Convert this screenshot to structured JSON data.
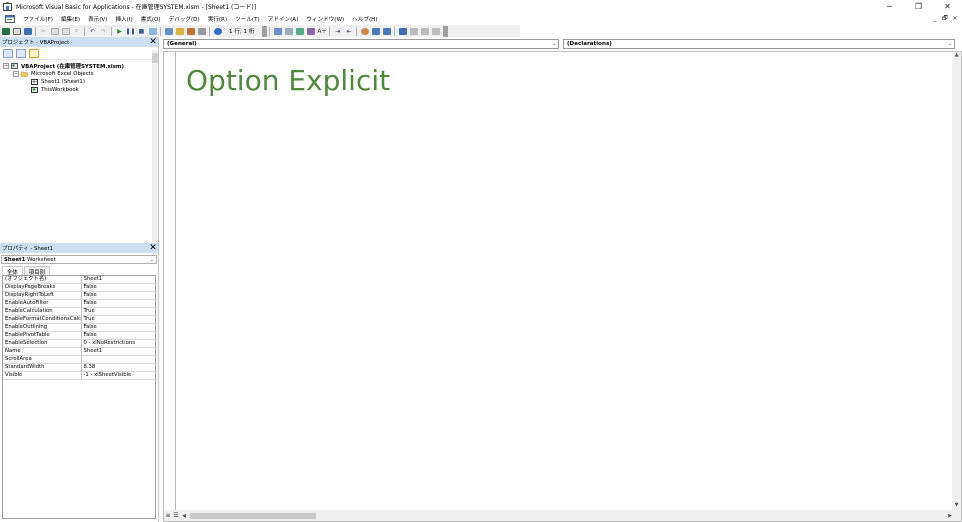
{
  "window": {
    "title": "Microsoft Visual Basic for Applications - 在庫管理SYSTEM.xlsm - [Sheet1 (コード)]",
    "minimize": "─",
    "restore": "❐",
    "close": "✕"
  },
  "menubar": {
    "items": [
      "ファイル(F)",
      "編集(E)",
      "表示(V)",
      "挿入(I)",
      "書式(O)",
      "デバッグ(D)",
      "実行(R)",
      "ツール(T)",
      "アドイン(A)",
      "ウィンドウ(W)",
      "ヘルプ(H)"
    ],
    "mdi_min": "_",
    "mdi_restore": "🗗",
    "mdi_close": "✕"
  },
  "toolbar": {
    "cursor_position": "1 行, 1 桁"
  },
  "project_panel": {
    "title": "プロジェクト - VBAProject",
    "close": "✕",
    "tree": {
      "root": "VBAProject (在庫管理SYSTEM.xlsm)",
      "folder": "Microsoft Excel Objects",
      "items": [
        "Sheet1 (Sheet1)",
        "ThisWorkbook"
      ]
    }
  },
  "properties_panel": {
    "title": "プロパティ - Sheet1",
    "close": "✕",
    "object_name": "Sheet1",
    "object_type": "Worksheet",
    "tabs": [
      "全体",
      "項目別"
    ],
    "rows": [
      [
        "(オブジェクト名)",
        "Sheet1"
      ],
      [
        "DisplayPageBreaks",
        "False"
      ],
      [
        "DisplayRightToLeft",
        "False"
      ],
      [
        "EnableAutoFilter",
        "False"
      ],
      [
        "EnableCalculation",
        "True"
      ],
      [
        "EnableFormatConditionsCalcu",
        "True"
      ],
      [
        "EnableOutlining",
        "False"
      ],
      [
        "EnablePivotTable",
        "False"
      ],
      [
        "EnableSelection",
        "0 - xlNoRestrictions"
      ],
      [
        "Name",
        "Sheet1"
      ],
      [
        "ScrollArea",
        ""
      ],
      [
        "StandardWidth",
        "8.38"
      ],
      [
        "Visible",
        "-1 - xlSheetVisible"
      ]
    ]
  },
  "code_window": {
    "object_combo": "(General)",
    "procedure_combo": "(Declarations)",
    "code_text": "Option Explicit"
  },
  "colors": {
    "code_green": "#4e8a3a",
    "panel_title_bg": "#cde0f2"
  }
}
